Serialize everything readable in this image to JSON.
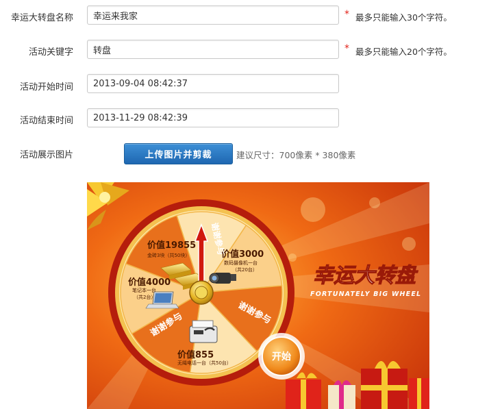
{
  "form": {
    "name": {
      "label": "幸运大转盘名称",
      "value": "幸运来我家",
      "required_mark": "*",
      "hint": "最多只能输入30个字符。"
    },
    "keyword": {
      "label": "活动关键字",
      "value": "转盘",
      "required_mark": "*",
      "hint": "最多只能输入20个字符。"
    },
    "start_time": {
      "label": "活动开始时间",
      "value": "2013-09-04 08:42:37"
    },
    "end_time": {
      "label": "活动结束时间",
      "value": "2013-11-29 08:42:39"
    },
    "image": {
      "label": "活动展示图片",
      "upload_label": "上传图片并剪裁",
      "size_hint": "建议尺寸：700像素 * 380像素"
    }
  },
  "banner": {
    "title": "幸运大转盘",
    "subtitle": "FORTUNATELY BIG WHEEL",
    "start_label": "开始",
    "prizes": [
      {
        "name": "价值19855",
        "desc": "金砖3块（共50块）"
      },
      {
        "name": "价值3000",
        "desc": "数码摄像机一台",
        "count": "（共20台）"
      },
      {
        "name": "谢谢参与"
      },
      {
        "name": "价值855",
        "desc": "无绳电话一台（共50台）"
      },
      {
        "name": "谢谢参与"
      },
      {
        "name": "价值4000",
        "desc": "笔记本一台",
        "count": "（共2台）"
      },
      {
        "name": "谢谢参与"
      }
    ]
  },
  "colors": {
    "accent": "#1e67b1",
    "required": "#e2231a",
    "banner_bg": "#e04a10"
  }
}
